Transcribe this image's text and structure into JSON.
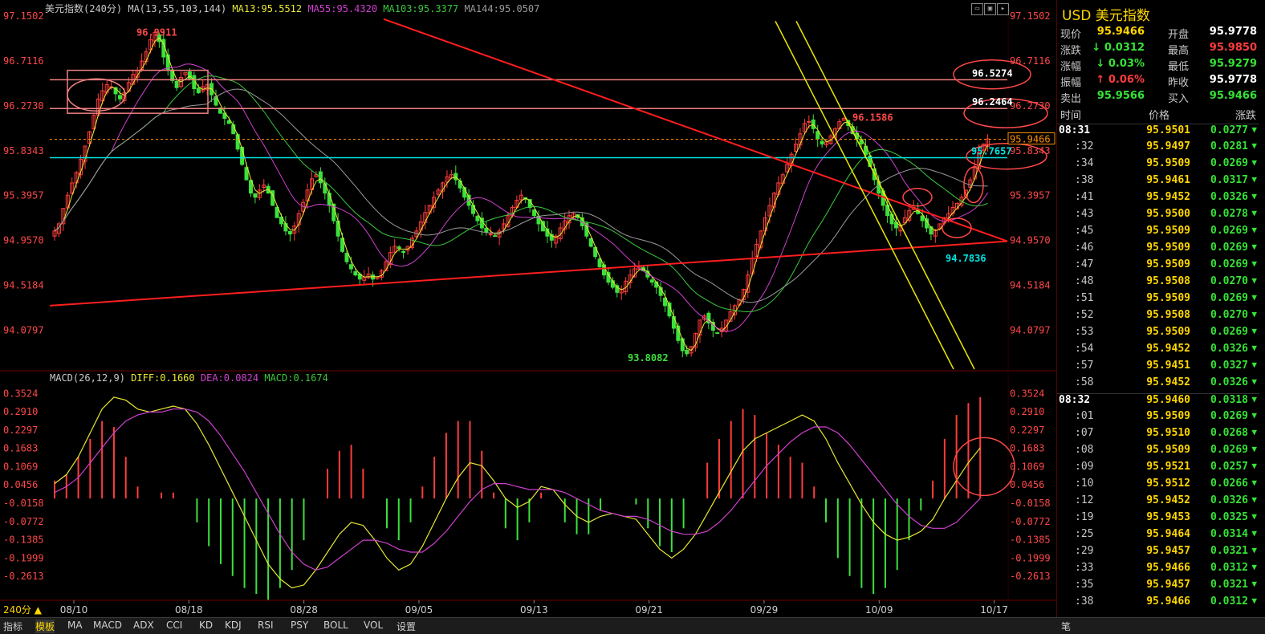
{
  "header": {
    "title": "美元指数(240分)",
    "ma_label": "MA(13,55,103,144)",
    "ma13": "MA13:95.5512",
    "ma55": "MA55:95.4320",
    "ma103": "MA103:95.3377",
    "ma144": "MA144:95.0507"
  },
  "macd_header": {
    "label": "MACD(26,12,9)",
    "diff": "DIFF:0.1660",
    "dea": "DEA:0.0824",
    "macd": "MACD:0.1674"
  },
  "colors": {
    "up": "#ff3c3c",
    "down": "#3ce13c",
    "ma13": "#e8e833",
    "ma55": "#d040d0",
    "ma103": "#3cc83c",
    "ma144": "#9a9a9a",
    "hline": "#00e5e5",
    "trend": "#ff1e1e",
    "channel": "#e8e800",
    "box": "#f08080"
  },
  "chart_data": {
    "type": "candlestick",
    "price_axis_ticks": [
      "97.1502",
      "96.7116",
      "96.2730",
      "95.8343",
      "95.3957",
      "94.9570",
      "94.5184",
      "94.0797"
    ],
    "price_ylim": [
      93.7,
      97.15
    ],
    "date_ticks": [
      "08/10",
      "08/18",
      "08/28",
      "09/05",
      "09/13",
      "09/21",
      "09/29",
      "10/09",
      "10/17"
    ],
    "price_closes": [
      95.05,
      95.12,
      95.27,
      95.4,
      95.52,
      95.62,
      95.75,
      95.88,
      96.02,
      96.18,
      96.34,
      96.42,
      96.48,
      96.46,
      96.39,
      96.34,
      96.4,
      96.5,
      96.58,
      96.62,
      96.71,
      96.8,
      96.92,
      96.99,
      96.9,
      96.75,
      96.62,
      96.52,
      96.45,
      96.55,
      96.6,
      96.54,
      96.44,
      96.4,
      96.46,
      96.48,
      96.38,
      96.28,
      96.2,
      96.15,
      96.1,
      96.0,
      95.85,
      95.7,
      95.55,
      95.42,
      95.38,
      95.45,
      95.5,
      95.42,
      95.3,
      95.18,
      95.12,
      95.05,
      95.02,
      95.1,
      95.22,
      95.33,
      95.45,
      95.56,
      95.6,
      95.52,
      95.42,
      95.3,
      95.15,
      95.0,
      94.85,
      94.75,
      94.68,
      94.62,
      94.58,
      94.6,
      94.63,
      94.58,
      94.6,
      94.66,
      94.75,
      94.84,
      94.9,
      94.88,
      94.84,
      94.9,
      94.98,
      95.05,
      95.14,
      95.23,
      95.3,
      95.38,
      95.45,
      95.52,
      95.58,
      95.6,
      95.55,
      95.47,
      95.38,
      95.3,
      95.22,
      95.15,
      95.08,
      95.04,
      95.02,
      95.0,
      95.05,
      95.12,
      95.2,
      95.28,
      95.35,
      95.4,
      95.36,
      95.28,
      95.2,
      95.12,
      95.05,
      95.0,
      94.96,
      95.0,
      95.08,
      95.15,
      95.2,
      95.22,
      95.18,
      95.1,
      95.0,
      94.9,
      94.8,
      94.7,
      94.62,
      94.55,
      94.5,
      94.45,
      94.48,
      94.56,
      94.62,
      94.68,
      94.7,
      94.66,
      94.6,
      94.55,
      94.5,
      94.42,
      94.32,
      94.22,
      94.1,
      93.98,
      93.88,
      93.85,
      93.92,
      94.05,
      94.18,
      94.22,
      94.15,
      94.08,
      94.05,
      94.1,
      94.18,
      94.26,
      94.32,
      94.38,
      94.48,
      94.62,
      94.78,
      94.92,
      95.05,
      95.18,
      95.3,
      95.42,
      95.52,
      95.6,
      95.7,
      95.8,
      95.9,
      96.0,
      96.1,
      96.12,
      96.05,
      95.95,
      95.9,
      95.92,
      95.98,
      96.05,
      96.12,
      96.15,
      96.08,
      96.0,
      95.95,
      95.9,
      95.8,
      95.68,
      95.55,
      95.42,
      95.3,
      95.2,
      95.12,
      95.08,
      95.1,
      95.18,
      95.25,
      95.28,
      95.22,
      95.15,
      95.08,
      95.02,
      95.06,
      95.12,
      95.18,
      95.22,
      95.28,
      95.32,
      95.38,
      95.45,
      95.55,
      95.68,
      95.82,
      95.9,
      95.95
    ],
    "high_low_labels": [
      "96.9911",
      "96.1586",
      "95.7657",
      "94.7836",
      "93.8082"
    ],
    "price_box_labels": [
      "96.5274",
      "96.2464",
      "95.9466"
    ],
    "macd_axis_ticks": [
      "0.3524",
      "0.2910",
      "0.2297",
      "0.1683",
      "0.1069",
      "0.0456",
      "-0.0158",
      "-0.0772",
      "-0.1385",
      "-0.1999",
      "-0.2613"
    ],
    "macd_ylim": [
      -0.32,
      0.38
    ],
    "diff": [
      0.05,
      0.08,
      0.14,
      0.22,
      0.3,
      0.34,
      0.33,
      0.3,
      0.29,
      0.3,
      0.31,
      0.3,
      0.25,
      0.18,
      0.1,
      0.02,
      -0.06,
      -0.14,
      -0.22,
      -0.27,
      -0.3,
      -0.29,
      -0.24,
      -0.18,
      -0.12,
      -0.08,
      -0.09,
      -0.14,
      -0.2,
      -0.24,
      -0.22,
      -0.16,
      -0.08,
      0.0,
      0.07,
      0.12,
      0.11,
      0.06,
      0.0,
      -0.03,
      -0.01,
      0.04,
      0.03,
      -0.02,
      -0.06,
      -0.08,
      -0.06,
      -0.05,
      -0.06,
      -0.07,
      -0.12,
      -0.17,
      -0.2,
      -0.17,
      -0.12,
      -0.05,
      0.02,
      0.09,
      0.16,
      0.2,
      0.22,
      0.24,
      0.26,
      0.28,
      0.26,
      0.2,
      0.12,
      0.05,
      -0.02,
      -0.08,
      -0.12,
      -0.14,
      -0.13,
      -0.11,
      -0.07,
      0.0,
      0.06,
      0.12,
      0.17
    ],
    "dea": [
      0.02,
      0.04,
      0.07,
      0.12,
      0.17,
      0.22,
      0.26,
      0.28,
      0.29,
      0.29,
      0.3,
      0.3,
      0.29,
      0.26,
      0.21,
      0.15,
      0.09,
      0.02,
      -0.05,
      -0.12,
      -0.18,
      -0.22,
      -0.24,
      -0.23,
      -0.2,
      -0.17,
      -0.14,
      -0.14,
      -0.15,
      -0.17,
      -0.18,
      -0.18,
      -0.15,
      -0.11,
      -0.06,
      -0.01,
      0.03,
      0.05,
      0.05,
      0.04,
      0.03,
      0.03,
      0.03,
      0.02,
      0.0,
      -0.02,
      -0.04,
      -0.05,
      -0.06,
      -0.06,
      -0.07,
      -0.09,
      -0.11,
      -0.12,
      -0.12,
      -0.11,
      -0.08,
      -0.04,
      0.01,
      0.06,
      0.11,
      0.15,
      0.19,
      0.22,
      0.24,
      0.24,
      0.22,
      0.18,
      0.13,
      0.08,
      0.03,
      -0.02,
      -0.06,
      -0.09,
      -0.1,
      -0.1,
      -0.08,
      -0.04,
      0.0
    ]
  },
  "quote_panel": {
    "title": "USD 美元指数",
    "rows": [
      {
        "l1": "现价",
        "v1": "95.9466",
        "v1c": "#ffd700",
        "l2": "开盘",
        "v2": "95.9778",
        "v2c": "#ffffff"
      },
      {
        "l1": "涨跌",
        "v1": "↓ 0.0312",
        "v1c": "#36e236",
        "l2": "最高",
        "v2": "95.9850",
        "v2c": "#ff3c3c"
      },
      {
        "l1": "涨幅",
        "v1": "↓ 0.03%",
        "v1c": "#36e236",
        "l2": "最低",
        "v2": "95.9279",
        "v2c": "#36e236"
      },
      {
        "l1": "振幅",
        "v1": "↑ 0.06%",
        "v1c": "#ff3c3c",
        "l2": "昨收",
        "v2": "95.9778",
        "v2c": "#ffffff"
      },
      {
        "l1": "卖出",
        "v1": "95.9566",
        "v1c": "#36e236",
        "l2": "买入",
        "v2": "95.9466",
        "v2c": "#36e236"
      }
    ],
    "table_headers": [
      "时间",
      "价格",
      "涨跌"
    ],
    "ticks": [
      {
        "t": "08:31",
        "p": "95.9501",
        "c": "0.0277"
      },
      {
        "t": ":32",
        "p": "95.9497",
        "c": "0.0281"
      },
      {
        "t": ":34",
        "p": "95.9509",
        "c": "0.0269"
      },
      {
        "t": ":38",
        "p": "95.9461",
        "c": "0.0317"
      },
      {
        "t": ":41",
        "p": "95.9452",
        "c": "0.0326"
      },
      {
        "t": ":43",
        "p": "95.9500",
        "c": "0.0278"
      },
      {
        "t": ":45",
        "p": "95.9509",
        "c": "0.0269"
      },
      {
        "t": ":46",
        "p": "95.9509",
        "c": "0.0269"
      },
      {
        "t": ":47",
        "p": "95.9509",
        "c": "0.0269"
      },
      {
        "t": ":48",
        "p": "95.9508",
        "c": "0.0270"
      },
      {
        "t": ":51",
        "p": "95.9509",
        "c": "0.0269"
      },
      {
        "t": ":52",
        "p": "95.9508",
        "c": "0.0270"
      },
      {
        "t": ":53",
        "p": "95.9509",
        "c": "0.0269"
      },
      {
        "t": ":54",
        "p": "95.9452",
        "c": "0.0326"
      },
      {
        "t": ":57",
        "p": "95.9451",
        "c": "0.0327"
      },
      {
        "t": ":58",
        "p": "95.9452",
        "c": "0.0326"
      },
      {
        "t": "08:32",
        "p": "95.9460",
        "c": "0.0318"
      },
      {
        "t": ":01",
        "p": "95.9509",
        "c": "0.0269"
      },
      {
        "t": ":07",
        "p": "95.9510",
        "c": "0.0268"
      },
      {
        "t": ":08",
        "p": "95.9509",
        "c": "0.0269"
      },
      {
        "t": ":09",
        "p": "95.9521",
        "c": "0.0257"
      },
      {
        "t": ":10",
        "p": "95.9512",
        "c": "0.0266"
      },
      {
        "t": ":12",
        "p": "95.9452",
        "c": "0.0326"
      },
      {
        "t": ":19",
        "p": "95.9453",
        "c": "0.0325"
      },
      {
        "t": ":25",
        "p": "95.9464",
        "c": "0.0314"
      },
      {
        "t": ":29",
        "p": "95.9457",
        "c": "0.0321"
      },
      {
        "t": ":33",
        "p": "95.9466",
        "c": "0.0312"
      },
      {
        "t": ":35",
        "p": "95.9457",
        "c": "0.0321"
      },
      {
        "t": ":38",
        "p": "95.9466",
        "c": "0.0312"
      }
    ]
  },
  "period_label": "240分 ▲",
  "bottom_tabs": [
    "指标",
    "模板",
    "MA",
    "MACD",
    "ADX",
    "CCI",
    "KD",
    "KDJ",
    "RSI",
    "PSY",
    "BOLL",
    "VOL",
    "设置"
  ],
  "panel_footer": "笔"
}
